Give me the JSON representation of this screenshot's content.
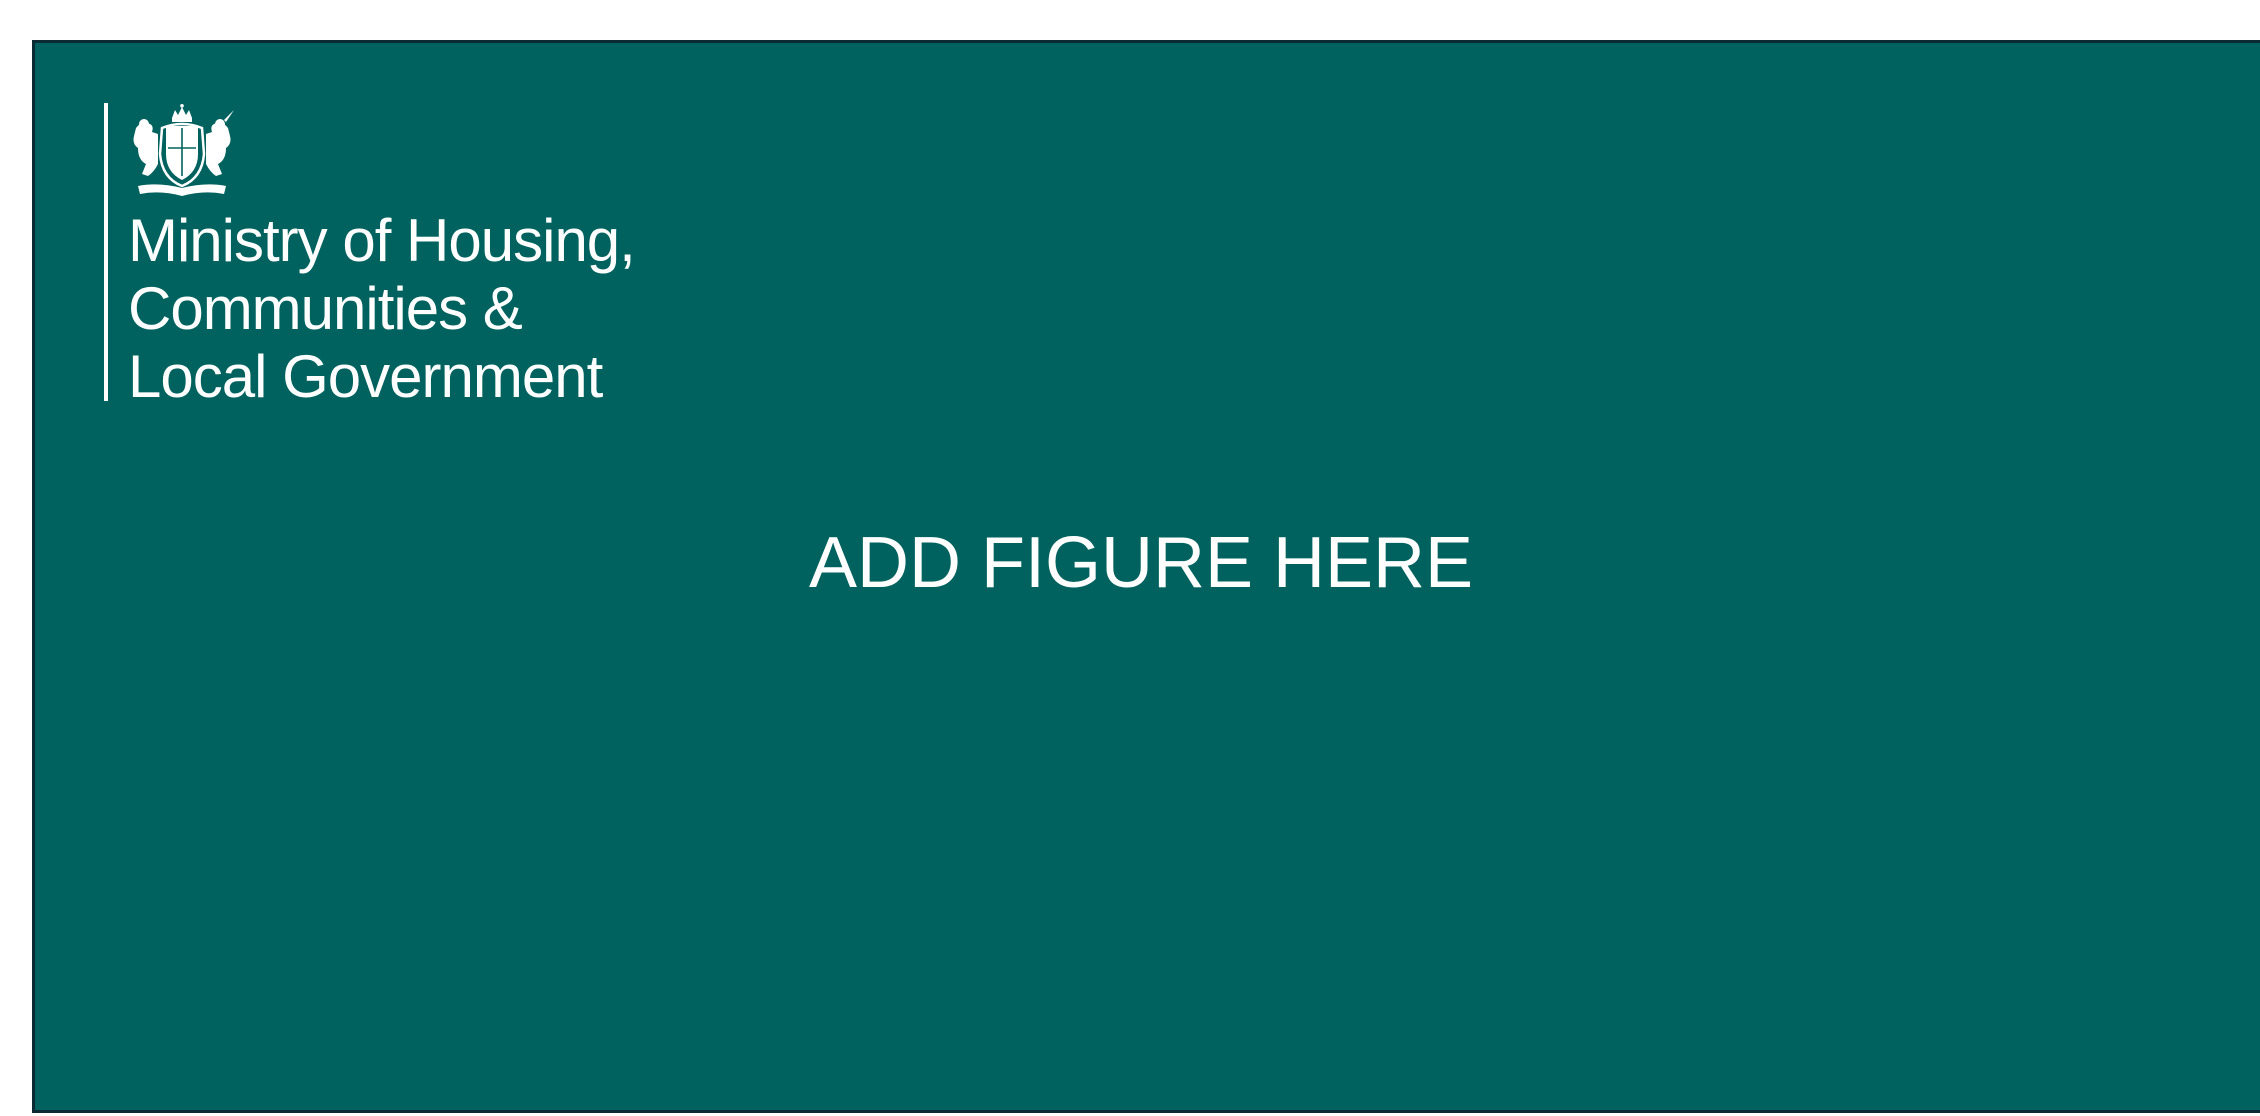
{
  "branding": {
    "org_name_lines": [
      "Ministry of Housing,",
      "Communities &",
      "Local Government"
    ],
    "crest_icon": "royal-coat-of-arms-icon"
  },
  "content": {
    "placeholder_text": "ADD FIGURE HERE"
  },
  "colors": {
    "panel_background": "#00625e",
    "panel_border": "#0b2a33",
    "text": "#ffffff",
    "page_background": "#ffffff"
  }
}
